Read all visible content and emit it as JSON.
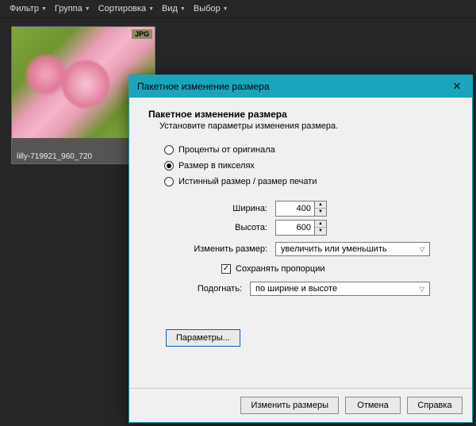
{
  "menubar": {
    "items": [
      "Фильтр",
      "Группа",
      "Сортировка",
      "Вид",
      "Выбор"
    ]
  },
  "thumb": {
    "badge": "JPG",
    "caption": "lilly-719921_960_720"
  },
  "dialog": {
    "title": "Пакетное изменение размера",
    "heading": "Пакетное изменение размера",
    "subheading": "Установите параметры изменения размера.",
    "radios": {
      "percent": "Проценты от оригинала",
      "pixels": "Размер в пикселях",
      "print": "Истинный размер / размер печати",
      "selected": "pixels"
    },
    "width_label": "Ширина:",
    "width_value": "400",
    "height_label": "Высота:",
    "height_value": "600",
    "resize_label": "Изменить размер:",
    "resize_value": "увеличить или уменьшить",
    "preserve_label": "Сохранять пропорции",
    "preserve_checked": true,
    "fit_label": "Подогнать:",
    "fit_value": "по ширине и высоте",
    "params_btn": "Параметры...",
    "buttons": {
      "resize": "Изменить размеры",
      "cancel": "Отмена",
      "help": "Справка"
    }
  }
}
